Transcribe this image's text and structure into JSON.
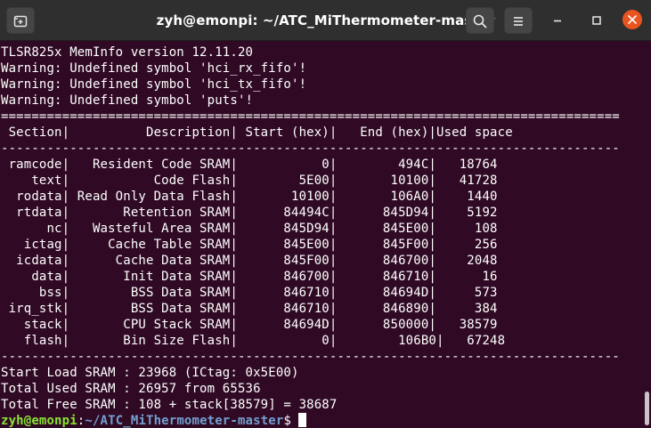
{
  "window": {
    "title": "zyh@emonpi: ~/ATC_MiThermometer-master",
    "new_tab_icon": "new-tab-icon",
    "search_icon": "search-icon",
    "menu_icon": "hamburger-menu-icon",
    "minimize_icon": "minimize-icon",
    "maximize_icon": "maximize-icon",
    "close_icon": "close-icon",
    "accent_close": "#e95420",
    "terminal_bg": "#300a24"
  },
  "terminal": {
    "lines": [
      "TLSR825x MemInfo version 12.11.20",
      "Warning: Undefined symbol 'hci_rx_fifo'!",
      "Warning: Undefined symbol 'hci_tx_fifo'!",
      "Warning: Undefined symbol 'puts'!",
      "=================================================================================",
      " Section|          Description| Start (hex)|   End (hex)|Used space",
      "---------------------------------------------------------------------------------",
      " ramcode|   Resident Code SRAM|           0|        494C|   18764",
      "    text|           Code Flash|        5E00|       10100|   41728",
      "  rodata| Read Only Data Flash|       10100|       106A0|    1440",
      "  rtdata|       Retention SRAM|      84494C|      845D94|    5192",
      "      nc|   Wasteful Area SRAM|      845D94|      845E00|     108",
      "   ictag|     Cache Table SRAM|      845E00|      845F00|     256",
      "  icdata|      Cache Data SRAM|      845F00|      846700|    2048",
      "    data|       Init Data SRAM|      846700|      846710|      16",
      "     bss|        BSS Data SRAM|      846710|      84694D|     573",
      " irq_stk|        BSS Data SRAM|      846710|      846890|     384",
      "   stack|       CPU Stack SRAM|      84694D|      850000|   38579",
      "   flash|       Bin Size Flash|           0|        106B0|   67248",
      "---------------------------------------------------------------------------------",
      "Start Load SRAM : 23968 (ICtag: 0x5E00)",
      "Total Used SRAM : 26957 from 65536",
      "Total Free SRAM : 108 + stack[38579] = 38687"
    ],
    "prompt": {
      "user_host": "zyh@emonpi",
      "colon": ":",
      "path": "~/ATC_MiThermometer-master",
      "sign": "$"
    }
  }
}
